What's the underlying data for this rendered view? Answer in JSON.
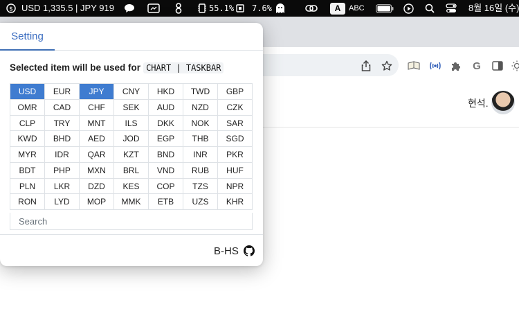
{
  "menubar": {
    "ticker": "USD 1,335.5 | JPY 919",
    "cpu_pct": "55.1%",
    "mem_pct": "7.6%",
    "input_source": "ABC",
    "input_letter": "A",
    "date": "8월 16일 (수)",
    "icons": [
      "chat-bubble-icon",
      "screen-share-icon",
      "accessibility-icon",
      "cpu-chip-icon",
      "ghost-icon",
      "link-icon",
      "battery-icon",
      "play-icon",
      "search-icon",
      "control-center-icon"
    ]
  },
  "browser": {
    "toolbar_icons": [
      "share-icon",
      "bookmark-star-icon",
      "reader-icon",
      "extension-wave-icon",
      "puzzle-icon",
      "google-icon",
      "sidebar-icon",
      "brightness-icon"
    ],
    "google_letter": "G"
  },
  "page": {
    "username": "현석."
  },
  "popup": {
    "tab_label": "Setting",
    "heading": "Selected item will be used for",
    "code_label": "CHART | TASKBAR",
    "currencies": [
      "USD",
      "EUR",
      "JPY",
      "CNY",
      "HKD",
      "TWD",
      "GBP",
      "OMR",
      "CAD",
      "CHF",
      "SEK",
      "AUD",
      "NZD",
      "CZK",
      "CLP",
      "TRY",
      "MNT",
      "ILS",
      "DKK",
      "NOK",
      "SAR",
      "KWD",
      "BHD",
      "AED",
      "JOD",
      "EGP",
      "THB",
      "SGD",
      "MYR",
      "IDR",
      "QAR",
      "KZT",
      "BND",
      "INR",
      "PKR",
      "BDT",
      "PHP",
      "MXN",
      "BRL",
      "VND",
      "RUB",
      "HUF",
      "PLN",
      "LKR",
      "DZD",
      "KES",
      "COP",
      "TZS",
      "NPR",
      "RON",
      "LYD",
      "MOP",
      "MMK",
      "ETB",
      "UZS",
      "KHR"
    ],
    "selected": [
      "USD",
      "JPY"
    ],
    "search_placeholder": "Search",
    "footer_brand": "B-HS",
    "footer_icon": "github-icon",
    "accent_color": "#3f7cd0"
  }
}
